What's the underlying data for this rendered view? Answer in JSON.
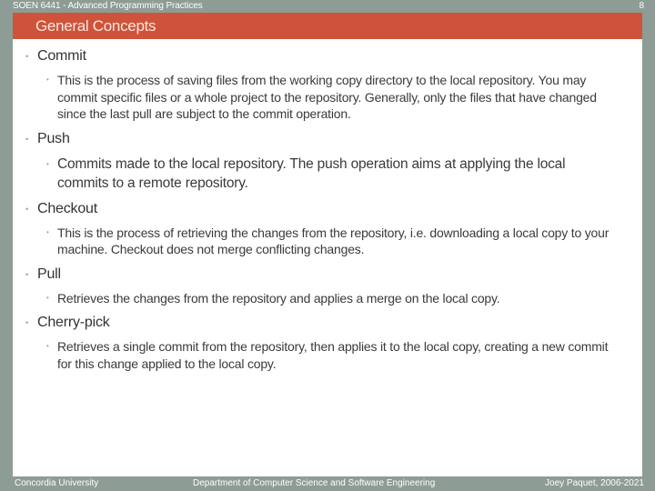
{
  "header": {
    "course": "SOEN 6441 - Advanced Programming Practices",
    "page_number": "8"
  },
  "slide": {
    "title": "General Concepts",
    "bullet_glyph": "•",
    "items": [
      {
        "label": "Commit",
        "details": [
          "This is the process of saving files from the working copy directory to the local repository. You may commit specific files or a whole project to the repository. Generally, only the files that have changed since the last pull are subject to the commit operation."
        ]
      },
      {
        "label": "Push",
        "details": [
          "Commits made to the local repository. The push operation aims at applying the local commits to a remote repository."
        ]
      },
      {
        "label": "Checkout",
        "details": [
          "This is the process of retrieving the changes from the repository, i.e. downloading a local copy to your machine. Checkout does not merge conflicting changes."
        ]
      },
      {
        "label": "Pull",
        "details": [
          "Retrieves the changes from the repository and applies a merge on the local copy."
        ]
      },
      {
        "label": "Cherry-pick",
        "details": [
          "Retrieves a single commit from the repository, then applies it to the local copy, creating a new commit for this change applied to the local copy."
        ]
      }
    ]
  },
  "footer": {
    "left": "Concordia University",
    "center": "Department of Computer Science and Software Engineering",
    "right": "Joey Paquet, 2006-2021"
  },
  "colors": {
    "background": "#8d9c94",
    "title_bar": "#cf533b",
    "title_text": "#fbe7dc",
    "body_text": "#333333"
  }
}
